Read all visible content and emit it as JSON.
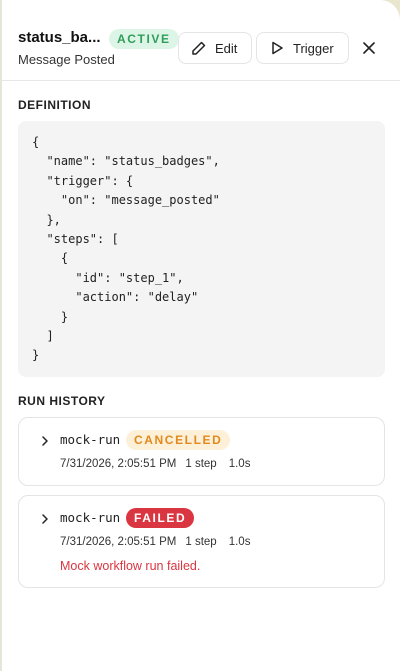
{
  "header": {
    "title": "status_ba...",
    "status_badge": "ACTIVE",
    "subtitle": "Message Posted",
    "edit_label": "Edit",
    "trigger_label": "Trigger"
  },
  "definition": {
    "label": "DEFINITION",
    "code": "{\n  \"name\": \"status_badges\",\n  \"trigger\": {\n    \"on\": \"message_posted\"\n  },\n  \"steps\": [\n    {\n      \"id\": \"step_1\",\n      \"action\": \"delay\"\n    }\n  ]\n}"
  },
  "run_history": {
    "label": "RUN HISTORY",
    "runs": [
      {
        "name": "mock-run",
        "status": "CANCELLED",
        "timestamp": "7/31/2026, 2:05:51 PM",
        "steps": "1 step",
        "duration": "1.0s",
        "error": ""
      },
      {
        "name": "mock-run",
        "status": "FAILED",
        "timestamp": "7/31/2026, 2:05:51 PM",
        "steps": "1 step",
        "duration": "1.0s",
        "error": "Mock workflow run failed."
      }
    ]
  },
  "colors": {
    "active_badge_bg": "#ddf5e6",
    "active_badge_text": "#2f9e5b",
    "cancelled_bg": "#fdf0d8",
    "cancelled_text": "#e28a1d",
    "failed_bg": "#d93641",
    "error_text": "#d93641"
  },
  "icons": {
    "edit": "pencil-icon",
    "trigger": "play-icon",
    "close": "close-icon",
    "expand": "chevron-right-icon"
  }
}
